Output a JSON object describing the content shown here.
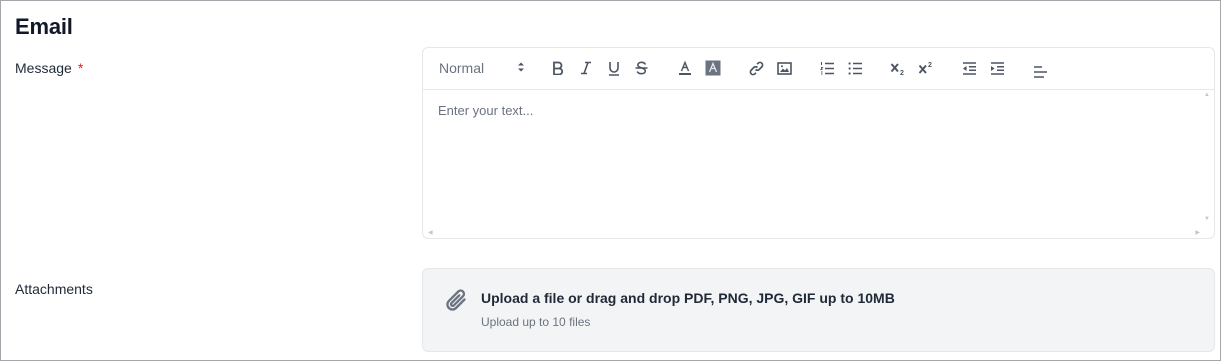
{
  "page": {
    "title": "Email"
  },
  "message": {
    "label": "Message",
    "required_mark": "*",
    "placeholder": "Enter your text...",
    "toolbar": {
      "format_value": "Normal",
      "buttons": [
        "bold-icon",
        "italic-icon",
        "underline-icon",
        "strikethrough-icon",
        "text-color-icon",
        "background-color-icon",
        "link-icon",
        "image-icon",
        "ordered-list-icon",
        "bullet-list-icon",
        "subscript-icon",
        "superscript-icon",
        "outdent-icon",
        "indent-icon",
        "align-icon"
      ]
    }
  },
  "attachments": {
    "label": "Attachments",
    "dropzone_title": "Upload a file or drag and drop PDF, PNG, JPG, GIF up to 10MB",
    "dropzone_subtitle": "Upload up to 10 files"
  },
  "colors": {
    "required": "#dc2626",
    "dropzone_bg": "#f3f4f6",
    "border": "#e5e7eb"
  }
}
